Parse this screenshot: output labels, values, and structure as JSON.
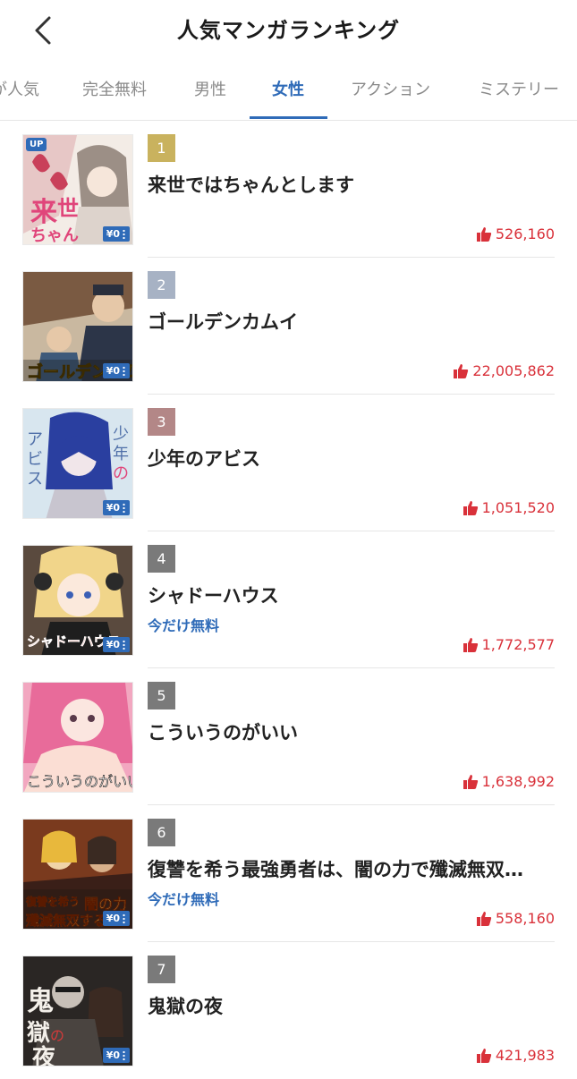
{
  "header": {
    "title": "人気マンガランキング",
    "back_icon": "chevron-left-icon"
  },
  "tabs": [
    {
      "label": "が人気",
      "active": false
    },
    {
      "label": "完全無料",
      "active": false
    },
    {
      "label": "男性",
      "active": false
    },
    {
      "label": "女性",
      "active": true
    },
    {
      "label": "アクション",
      "active": false
    },
    {
      "label": "ミステリー",
      "active": false
    }
  ],
  "colors": {
    "accent": "#2f6bb8",
    "likes": "#d9313a",
    "rank_1": "#c9b25e",
    "rank_2": "#a7b2c4",
    "rank_3": "#b38787",
    "rank_other": "#7a7a7a"
  },
  "items": [
    {
      "rank": "1",
      "title": "来世ではちゃんとします",
      "free_tag": "",
      "likes": "526,160",
      "up_badge": "UP",
      "price_badge": "¥0",
      "cover_text": "来世ではちゃんとします"
    },
    {
      "rank": "2",
      "title": "ゴールデンカムイ",
      "free_tag": "",
      "likes": "22,005,862",
      "up_badge": "",
      "price_badge": "¥0",
      "cover_text": "ゴールデンカムイ"
    },
    {
      "rank": "3",
      "title": "少年のアビス",
      "free_tag": "",
      "likes": "1,051,520",
      "up_badge": "",
      "price_badge": "¥0",
      "cover_text": "少年のアビス"
    },
    {
      "rank": "4",
      "title": "シャドーハウス",
      "free_tag": "今だけ無料",
      "likes": "1,772,577",
      "up_badge": "",
      "price_badge": "¥0",
      "cover_text": "シャドーハウス"
    },
    {
      "rank": "5",
      "title": "こういうのがいい",
      "free_tag": "",
      "likes": "1,638,992",
      "up_badge": "",
      "price_badge": "¥0",
      "cover_text": "こういうのがいい"
    },
    {
      "rank": "6",
      "title": "復讐を希う最強勇者は、闇の力で殲滅無双…",
      "free_tag": "今だけ無料",
      "likes": "558,160",
      "up_badge": "",
      "price_badge": "¥0",
      "cover_text": "復讐を希う最強勇者は闇の力で殲滅無双する"
    },
    {
      "rank": "7",
      "title": "鬼獄の夜",
      "free_tag": "",
      "likes": "421,983",
      "up_badge": "",
      "price_badge": "¥0",
      "cover_text": "鬼獄の夜"
    }
  ]
}
